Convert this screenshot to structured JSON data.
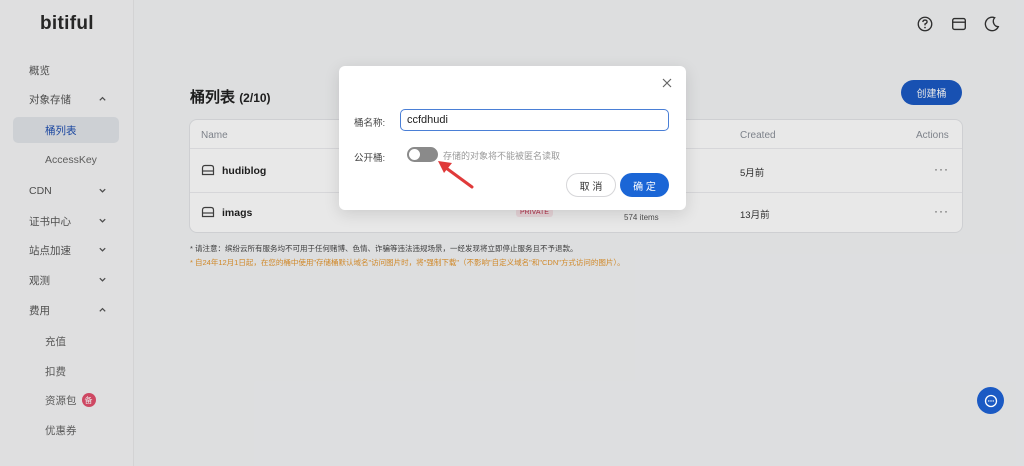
{
  "app": {
    "logo": "bitiful"
  },
  "header": {
    "icons": [
      "help-icon",
      "window-icon",
      "moon-icon"
    ]
  },
  "sidebar": {
    "items": [
      {
        "label": "概览"
      },
      {
        "label": "对象存储"
      },
      {
        "label": "桶列表"
      },
      {
        "label": "AccessKey"
      },
      {
        "label": "CDN"
      },
      {
        "label": "证书中心"
      },
      {
        "label": "站点加速"
      },
      {
        "label": "观测"
      },
      {
        "label": "费用"
      },
      {
        "label": "充值"
      },
      {
        "label": "扣费"
      },
      {
        "label": "资源包",
        "badge": "备"
      },
      {
        "label": "优惠券"
      }
    ]
  },
  "main": {
    "title": "桶列表",
    "count": "(2/10)",
    "create_button": "创建桶",
    "table": {
      "headers": {
        "name": "Name",
        "created": "Created",
        "actions": "Actions"
      },
      "rows": [
        {
          "name": "hudiblog",
          "created": "5月前",
          "actions": "···"
        },
        {
          "name": "imags",
          "tag": "PRIVATE",
          "items": "574 items",
          "created": "13月前",
          "actions": "···"
        }
      ]
    },
    "note1": "* 请注意：缤纷云所有服务均不可用于任何赌博、色情、诈骗等违法违规场景，一经发现将立即停止服务且不予退款。",
    "note2": "* 自24年12月1日起，在您的桶中使用\"存储桶默认域名\"访问图片时，将\"强制下载\"（不影响\"自定义域名\"和\"CDN\"方式访问的图片）。"
  },
  "dialog": {
    "name_label": "桶名称:",
    "name_value": "ccfdhudi",
    "public_label": "公开桶:",
    "public_desc": "存储的对象将不能被匿名读取",
    "public_enabled": false,
    "cancel_label": "取 消",
    "ok_label": "确 定"
  },
  "colors": {
    "accent": "#1b5ac4",
    "toggle_off": "#8a8a8a",
    "warning": "#e5962c",
    "arrow": "#e03a3a"
  }
}
